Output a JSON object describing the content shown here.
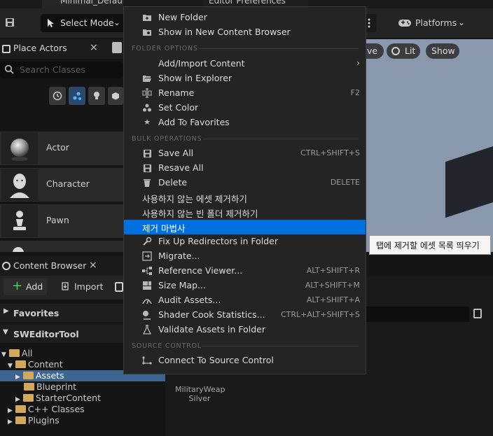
{
  "window": {
    "editor_tab": "Minimal_Default",
    "prefs_tab": "Editor Preferences"
  },
  "toolbar": {
    "select_mode": "Select Mode",
    "platforms": "Platforms"
  },
  "viewport": {
    "pill_cut": "ve",
    "lit": "Lit",
    "show": "Show"
  },
  "place_actors": {
    "title": "Place Actors",
    "close": "×",
    "search_placeholder": "Search Classes",
    "items": [
      {
        "label": "Actor"
      },
      {
        "label": "Character"
      },
      {
        "label": "Pawn"
      }
    ]
  },
  "content_browser": {
    "title": "Content Browser",
    "close": "×",
    "add": "Add",
    "import": "Import",
    "favorites": "Favorites",
    "project": "SWEditorTool",
    "tree": {
      "all": "All",
      "content": "Content",
      "assets": "Assets",
      "blueprint": "Blueprint",
      "starter": "StarterContent",
      "cpp": "C++ Classes",
      "plugins": "Plugins"
    },
    "asset_tile": {
      "name": "MilitaryWeap",
      "sub": "Silver"
    }
  },
  "tooltip": "탭에 제거할 에셋 목록 띄우기",
  "menu": {
    "new_folder": "New Folder",
    "show_new_cb": "Show in New Content Browser",
    "hdr_folder": "FOLDER OPTIONS",
    "add_import": "Add/Import Content",
    "show_explorer": "Show in Explorer",
    "rename": "Rename",
    "rename_sc": "F2",
    "set_color": "Set Color",
    "add_fav": "Add To Favorites",
    "hdr_bulk": "BULK OPERATIONS",
    "save_all": "Save All",
    "save_all_sc": "CTRL+SHIFT+S",
    "resave_all": "Resave All",
    "delete": "Delete",
    "delete_sc": "DELETE",
    "kr1": "사용하지 않는 에셋 제거하기",
    "kr2": "사용하지 않는 빈 폴더 제거하기",
    "kr3": "제거 마법사",
    "fix_redirectors": "Fix Up Redirectors in Folder",
    "migrate": "Migrate...",
    "ref_viewer": "Reference Viewer...",
    "ref_viewer_sc": "ALT+SHIFT+R",
    "size_map": "Size Map...",
    "size_map_sc": "ALT+SHIFT+M",
    "audit": "Audit Assets...",
    "audit_sc": "ALT+SHIFT+A",
    "shader_stats": "Shader Cook Statistics...",
    "shader_stats_sc": "CTRL+ALT+SHIFT+S",
    "validate": "Validate Assets in Folder",
    "hdr_source": "SOURCE CONTROL",
    "connect_sc": "Connect To Source Control"
  }
}
